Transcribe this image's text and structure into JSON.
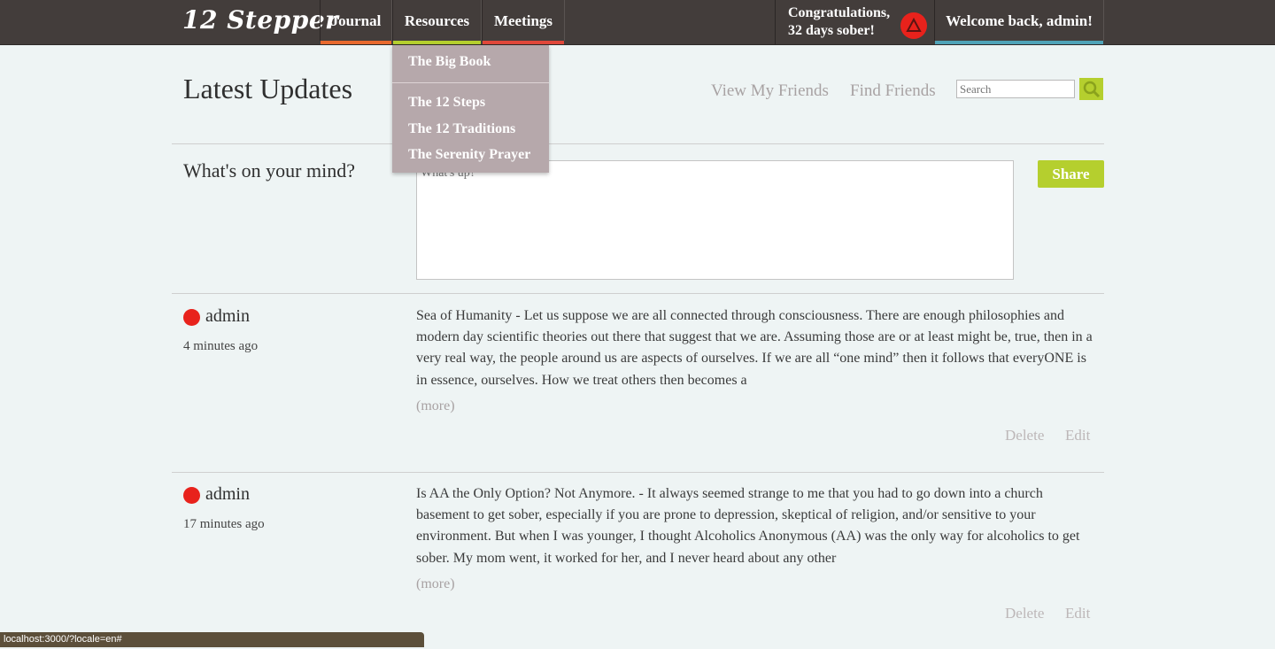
{
  "app": {
    "logo": "12 Stepper"
  },
  "nav": {
    "tabs": [
      {
        "label": "Journal",
        "accent": "#e8692e"
      },
      {
        "label": "Resources",
        "accent": "#b5cf2e"
      },
      {
        "label": "Meetings",
        "accent": "#e0473a"
      }
    ],
    "congrats_line1": "Congratulations,",
    "congrats_line2": "32 days sober!",
    "congrats_icon": "aa-triangle-icon",
    "welcome": "Welcome back, admin!",
    "welcome_accent": "#4fa3b8"
  },
  "resources_menu": {
    "items": [
      "The Big Book",
      "The 12 Steps",
      "The 12 Traditions",
      "The Serenity Prayer"
    ]
  },
  "header": {
    "title": "Latest Updates",
    "view_friends": "View My Friends",
    "find_friends": "Find Friends",
    "search_placeholder": "Search"
  },
  "composer": {
    "label": "What's on your mind?",
    "placeholder": "What's up?",
    "share": "Share"
  },
  "posts": [
    {
      "author": "admin",
      "time": "4 minutes ago",
      "text": "Sea of Humanity - Let us suppose we are all connected through consciousness. There are enough philosophies and modern day scientific theories out there that suggest that we are. Assuming those are or at least might be, true, then in a very real way, the people around us are aspects of ourselves. If we are all “one mind” then it follows that everyONE is in essence, ourselves. How we treat others then becomes a",
      "more": "(more)",
      "delete": "Delete",
      "edit": "Edit"
    },
    {
      "author": "admin",
      "time": "17 minutes ago",
      "text": "Is AA the Only Option? Not Anymore. - It always seemed strange to me that you had to go down into a church basement to get sober, especially if you are prone to depression, skeptical of religion, and/or sensitive to your environment. But when I was younger, I thought Alcoholics Anonymous (AA) was the only way for alcoholics to get sober. My mom went, it worked for her, and I never heard about any other",
      "more": "(more)",
      "delete": "Delete",
      "edit": "Edit"
    }
  ],
  "status_url": "localhost:3000/?locale=en#"
}
